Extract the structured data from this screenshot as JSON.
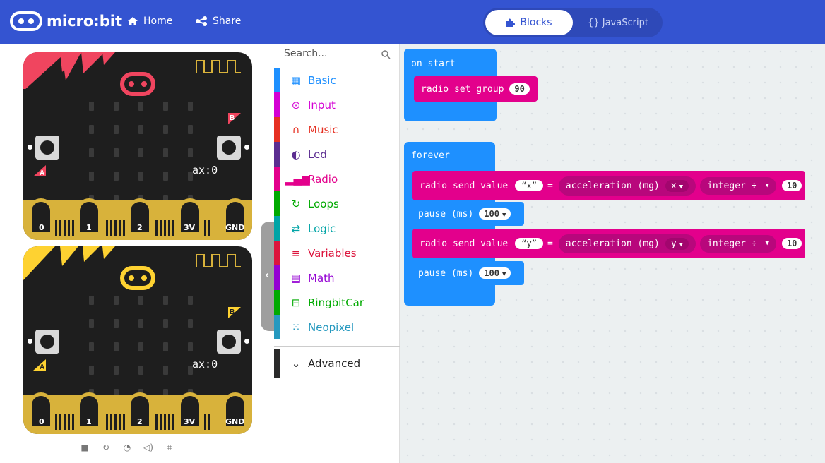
{
  "header": {
    "logo_text": "micro:bit",
    "home_label": "Home",
    "share_label": "Share",
    "blocks_tab": "Blocks",
    "js_tab": "{} JavaScript",
    "brand_color": "#3454d1"
  },
  "simulator": {
    "board1": {
      "readout": "ax:0",
      "accent": "#f0455f"
    },
    "board2": {
      "readout": "ax:0",
      "accent": "#fed231"
    },
    "button_a": "A",
    "button_b": "B",
    "pins": [
      "0",
      "1",
      "2",
      "3V",
      "GND"
    ],
    "toolbar_icons": [
      "stop-icon",
      "restart-icon",
      "slowmo-icon",
      "mute-icon",
      "screenshot-icon"
    ]
  },
  "toolbox": {
    "search_placeholder": "Search...",
    "categories": [
      {
        "label": "Basic",
        "icon": "grid-icon",
        "color": "#1e90ff"
      },
      {
        "label": "Input",
        "icon": "target-icon",
        "color": "#d400d4"
      },
      {
        "label": "Music",
        "icon": "headphones-icon",
        "color": "#e63022"
      },
      {
        "label": "Led",
        "icon": "toggle-icon",
        "color": "#5c2d91"
      },
      {
        "label": "Radio",
        "icon": "signal-icon",
        "color": "#e3008c"
      },
      {
        "label": "Loops",
        "icon": "loop-icon",
        "color": "#00aa00"
      },
      {
        "label": "Logic",
        "icon": "shuffle-icon",
        "color": "#00a4a6"
      },
      {
        "label": "Variables",
        "icon": "lines-icon",
        "color": "#dc143c"
      },
      {
        "label": "Math",
        "icon": "calculator-icon",
        "color": "#9400d3"
      },
      {
        "label": "RingbitCar",
        "icon": "car-icon",
        "color": "#00aa00"
      },
      {
        "label": "Neopixel",
        "icon": "dots-icon",
        "color": "#2699bf"
      }
    ],
    "advanced_label": "Advanced"
  },
  "workspace": {
    "on_start_label": "on start",
    "radio_set_group_label": "radio set group",
    "group_value": "90",
    "forever_label": "forever",
    "send_value_label": "radio send value",
    "send1": {
      "name": "x",
      "axis": "x"
    },
    "send2": {
      "name": "y",
      "axis": "y"
    },
    "equals": "=",
    "accel_label": "acceleration (mg)",
    "integer_label": "integer ÷",
    "divisor": "10",
    "pause_label": "pause (ms)",
    "pause_value": "100"
  }
}
